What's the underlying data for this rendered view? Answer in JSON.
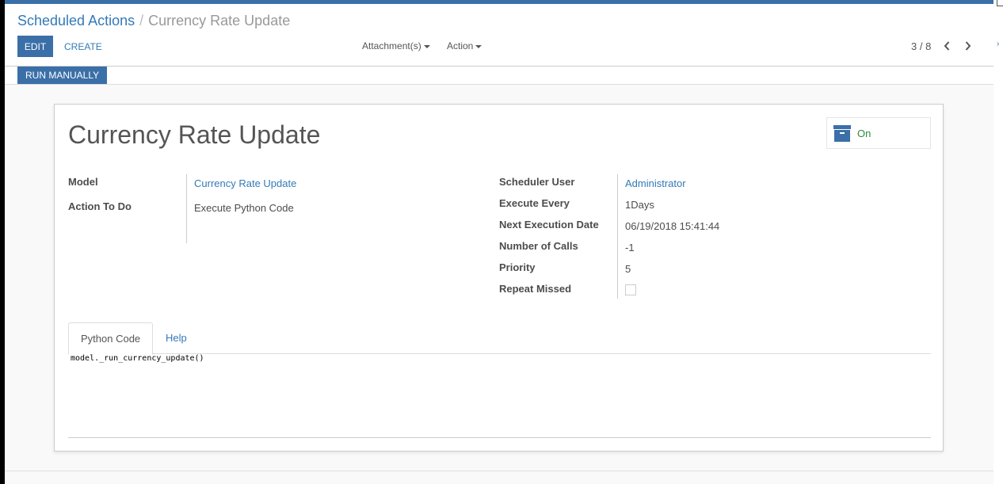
{
  "breadcrumb": {
    "parent": "Scheduled Actions",
    "separator": "/",
    "current": "Currency Rate Update"
  },
  "toolbar": {
    "edit_label": "EDIT",
    "create_label": "CREATE",
    "attachments_label": "Attachment(s)",
    "action_label": "Action"
  },
  "pager": {
    "value": "3 / 8",
    "prev_icon": "chevron-left-icon",
    "next_icon": "chevron-right-icon"
  },
  "statusbar": {
    "run_label": "RUN MANUALLY"
  },
  "record": {
    "title": "Currency Rate Update",
    "active_toggle": {
      "label": "On",
      "icon": "archive-box-icon"
    },
    "left_fields": [
      {
        "label": "Model",
        "value": "Currency Rate Update"
      },
      {
        "label": "Action To Do",
        "value": "Execute Python Code"
      }
    ],
    "right_fields": [
      {
        "label": "Scheduler User",
        "value": "Administrator"
      },
      {
        "label": "Execute Every",
        "value": "1Days"
      },
      {
        "label": "Next Execution Date",
        "value": "06/19/2018 15:41:44"
      },
      {
        "label": "Number of Calls",
        "value": "-1"
      },
      {
        "label": "Priority",
        "value": "5"
      },
      {
        "label": "Repeat Missed",
        "value": false
      }
    ]
  },
  "tabs": [
    {
      "label": "Python Code",
      "active": true
    },
    {
      "label": "Help",
      "active": false
    }
  ],
  "code": "model._run_currency_update()",
  "colors": {
    "primary": "#3b6fa8",
    "link": "#337ab7",
    "active_green": "#2d8a3e"
  }
}
